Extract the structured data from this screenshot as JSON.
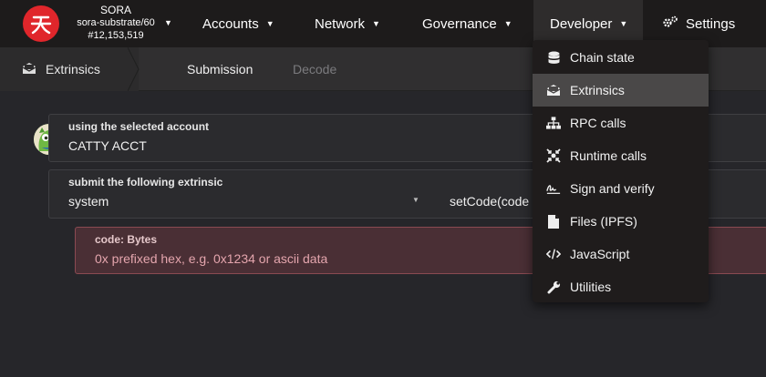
{
  "header": {
    "chain": {
      "name": "SORA",
      "runtime": "sora-substrate/60",
      "block": "#12,153,519"
    },
    "nav": {
      "accounts": "Accounts",
      "network": "Network",
      "governance": "Governance",
      "developer": "Developer",
      "settings": "Settings"
    }
  },
  "subheader": {
    "section": "Extrinsics",
    "tabs": {
      "submission": "Submission",
      "decode": "Decode"
    }
  },
  "form": {
    "account": {
      "label": "using the selected account",
      "value": "CATTY ACCT"
    },
    "extrinsic": {
      "label": "submit the following extrinsic",
      "module": "system",
      "call": "setCode(code"
    },
    "param": {
      "label": "code: Bytes",
      "placeholder": "0x prefixed hex, e.g. 0x1234 or ascii data"
    }
  },
  "developer_menu": {
    "items": [
      {
        "label": "Chain state",
        "icon": "database-icon"
      },
      {
        "label": "Extrinsics",
        "icon": "envelope-open-icon",
        "active": true
      },
      {
        "label": "RPC calls",
        "icon": "network-wired-icon"
      },
      {
        "label": "Runtime calls",
        "icon": "arrows-to-circle-icon"
      },
      {
        "label": "Sign and verify",
        "icon": "signature-icon"
      },
      {
        "label": "Files (IPFS)",
        "icon": "file-icon"
      },
      {
        "label": "JavaScript",
        "icon": "code-icon"
      },
      {
        "label": "Utilities",
        "icon": "wrench-icon"
      }
    ]
  },
  "colors": {
    "brand": "#e0262b",
    "topbar": "#1d1b1b",
    "error_bg": "#4a2f35",
    "menu_active": "#4a4848"
  }
}
